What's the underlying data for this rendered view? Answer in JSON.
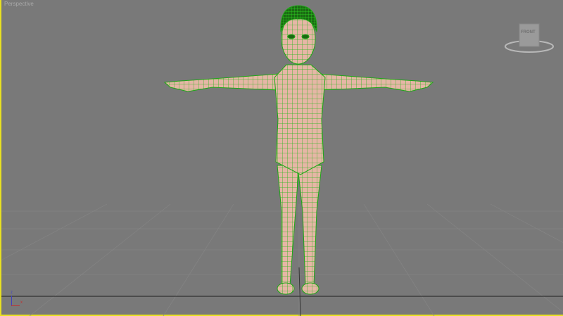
{
  "viewport": {
    "label": "Perspective"
  },
  "viewcube": {
    "face_label": "FRONT"
  },
  "axis_gizmo": {
    "z": "z",
    "x": "x"
  },
  "colors": {
    "background": "#797979",
    "active_border": "#e8e020",
    "wireframe": "#22c41a",
    "skin": "#e6b6a6"
  }
}
